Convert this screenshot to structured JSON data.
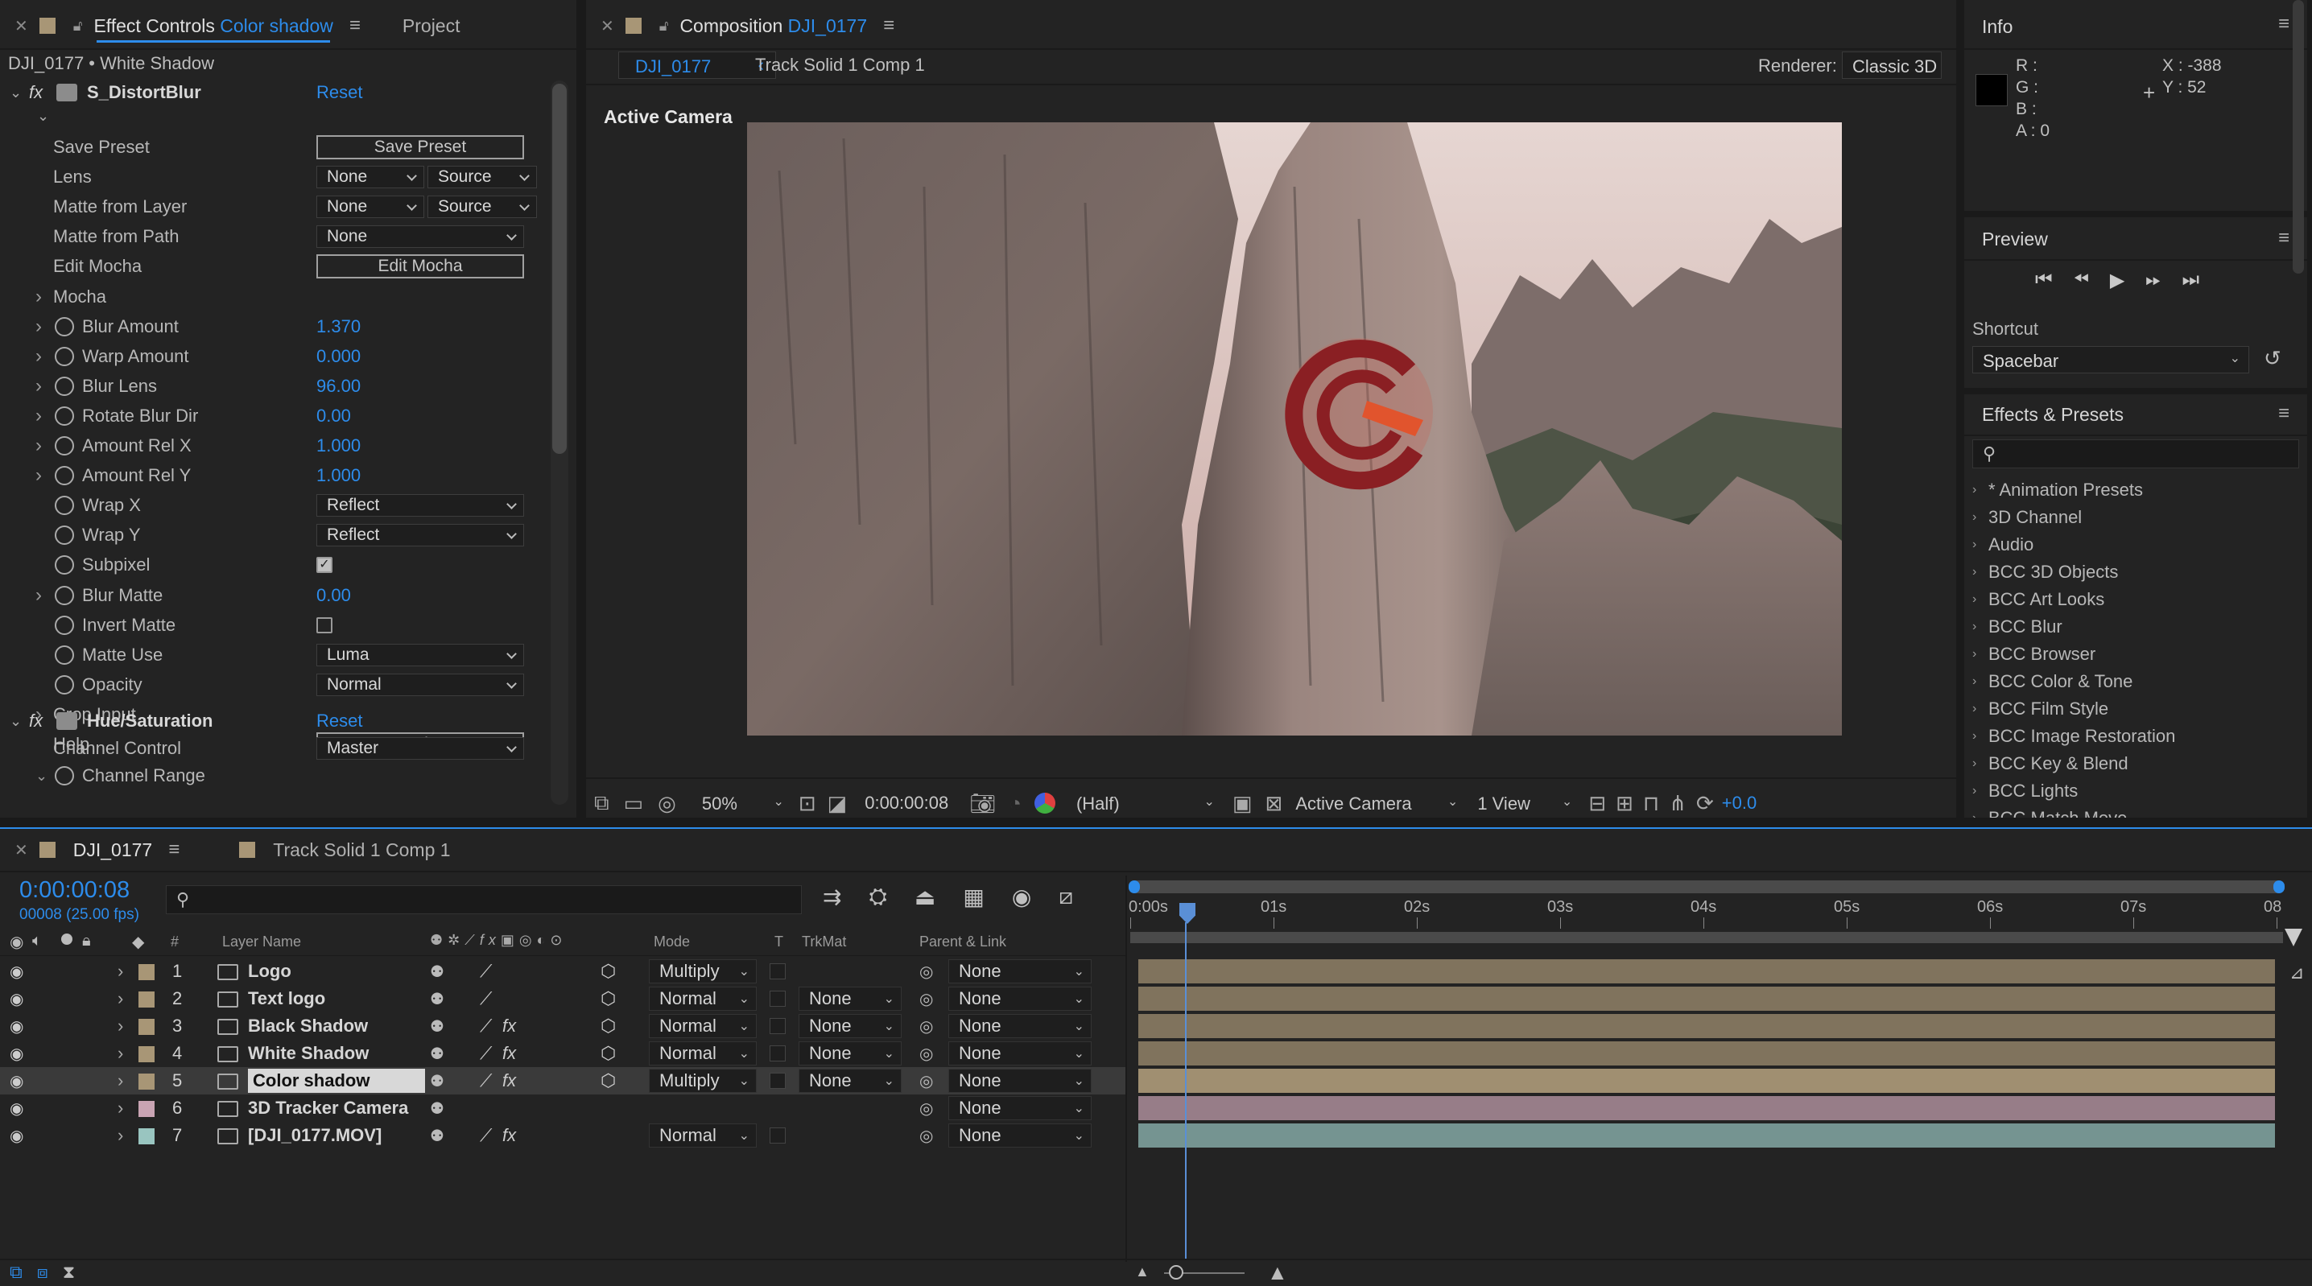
{
  "colors": {
    "accent": "#2d8ceb",
    "panel_bg": "#232323",
    "layer_tan": "#a89676",
    "layer_pink": "#c9a4b3",
    "layer_teal": "#99c5c0",
    "playhead": "#5a8fd6"
  },
  "effect_controls": {
    "tab_prefix": "Effect Controls",
    "tab_layer": "Color shadow",
    "project_tab": "Project",
    "breadcrumb": "DJI_0177 • White Shadow",
    "effect1": {
      "name": "S_DistortBlur",
      "reset": "Reset"
    },
    "rows": [
      {
        "label": "Save Preset",
        "kind": "button",
        "btn": "Save Preset"
      },
      {
        "label": "Lens",
        "kind": "dd2",
        "v1": "None",
        "v2": "Source"
      },
      {
        "label": "Matte from Layer",
        "kind": "dd2",
        "v1": "None",
        "v2": "Source"
      },
      {
        "label": "Matte from Path",
        "kind": "dd",
        "v1": "None"
      },
      {
        "label": "Edit Mocha",
        "kind": "button",
        "btn": "Edit Mocha"
      },
      {
        "label": "Mocha",
        "kind": "group"
      },
      {
        "label": "Blur Amount",
        "kind": "value",
        "value": "1.370"
      },
      {
        "label": "Warp Amount",
        "kind": "value",
        "value": "0.000"
      },
      {
        "label": "Blur Lens",
        "kind": "value",
        "value": "96.00"
      },
      {
        "label": "Rotate Blur Dir",
        "kind": "value",
        "value": "0.00"
      },
      {
        "label": "Amount Rel X",
        "kind": "value",
        "value": "1.000"
      },
      {
        "label": "Amount Rel Y",
        "kind": "value",
        "value": "1.000"
      },
      {
        "label": "Wrap X",
        "kind": "dd",
        "v1": "Reflect"
      },
      {
        "label": "Wrap Y",
        "kind": "dd",
        "v1": "Reflect"
      },
      {
        "label": "Subpixel",
        "kind": "check",
        "checked": true
      },
      {
        "label": "Blur Matte",
        "kind": "value",
        "value": "0.00"
      },
      {
        "label": "Invert Matte",
        "kind": "check",
        "checked": false
      },
      {
        "label": "Matte Use",
        "kind": "dd",
        "v1": "Luma"
      },
      {
        "label": "Opacity",
        "kind": "dd",
        "v1": "Normal"
      },
      {
        "label": "Crop Input",
        "kind": "group"
      },
      {
        "label": "Help",
        "kind": "button",
        "btn": "Help"
      }
    ],
    "effect2": {
      "name": "Hue/Saturation",
      "reset": "Reset"
    },
    "channel_control": {
      "label": "Channel Control",
      "value": "Master"
    },
    "channel_range": "Channel Range"
  },
  "composition": {
    "tab_prefix": "Composition",
    "tab_name": "DJI_0177",
    "crumb_active": "DJI_0177",
    "crumb_next": "Track Solid 1 Comp 1",
    "renderer_label": "Renderer:",
    "renderer_value": "Classic 3D",
    "view_label": "Active Camera",
    "zoom": "50%",
    "timecode": "0:00:00:08",
    "resolution": "(Half)",
    "camera": "Active Camera",
    "views": "1 View",
    "exposure": "+0.0"
  },
  "info": {
    "title": "Info",
    "r": "R :",
    "g": "G :",
    "b": "B :",
    "a": "A :  0",
    "x": "X : -388",
    "y": "Y : 52"
  },
  "preview": {
    "title": "Preview",
    "shortcut_label": "Shortcut",
    "shortcut_value": "Spacebar"
  },
  "effects_presets": {
    "title": "Effects & Presets",
    "items": [
      "* Animation Presets",
      "3D Channel",
      "Audio",
      "BCC 3D Objects",
      "BCC Art Looks",
      "BCC Blur",
      "BCC Browser",
      "BCC Color & Tone",
      "BCC Film Style",
      "BCC Image Restoration",
      "BCC Key & Blend",
      "BCC Lights",
      "BCC Match Move"
    ]
  },
  "timeline": {
    "tab1": "DJI_0177",
    "tab2": "Track Solid 1 Comp 1",
    "timecode": "0:00:00:08",
    "frame_info": "00008 (25.00 fps)",
    "headers": {
      "num": "#",
      "layer_name": "Layer Name",
      "mode": "Mode",
      "t": "T",
      "trkmat": "TrkMat",
      "parent": "Parent & Link"
    },
    "ruler": [
      "0:00s",
      "01s",
      "02s",
      "03s",
      "04s",
      "05s",
      "06s",
      "07s",
      "08"
    ],
    "layers": [
      {
        "num": "1",
        "name": "Logo",
        "mode": "Multiply",
        "trkmat": "",
        "parent": "None",
        "color": "#a89676",
        "fx": false,
        "selected": false
      },
      {
        "num": "2",
        "name": "Text logo",
        "mode": "Normal",
        "trkmat": "None",
        "parent": "None",
        "color": "#a89676",
        "fx": false,
        "selected": false
      },
      {
        "num": "3",
        "name": "Black Shadow",
        "mode": "Normal",
        "trkmat": "None",
        "parent": "None",
        "color": "#a89676",
        "fx": true,
        "selected": false
      },
      {
        "num": "4",
        "name": "White Shadow",
        "mode": "Normal",
        "trkmat": "None",
        "parent": "None",
        "color": "#a89676",
        "fx": true,
        "selected": false
      },
      {
        "num": "5",
        "name": "Color shadow",
        "mode": "Multiply",
        "trkmat": "None",
        "parent": "None",
        "color": "#a89676",
        "fx": true,
        "selected": true
      },
      {
        "num": "6",
        "name": "3D Tracker Camera",
        "mode": "",
        "trkmat": "",
        "parent": "None",
        "color": "#c9a4b3",
        "fx": false,
        "selected": false
      },
      {
        "num": "7",
        "name": "[DJI_0177.MOV]",
        "mode": "Normal",
        "trkmat": "",
        "parent": "None",
        "color": "#99c5c0",
        "fx": true,
        "selected": false
      }
    ]
  }
}
